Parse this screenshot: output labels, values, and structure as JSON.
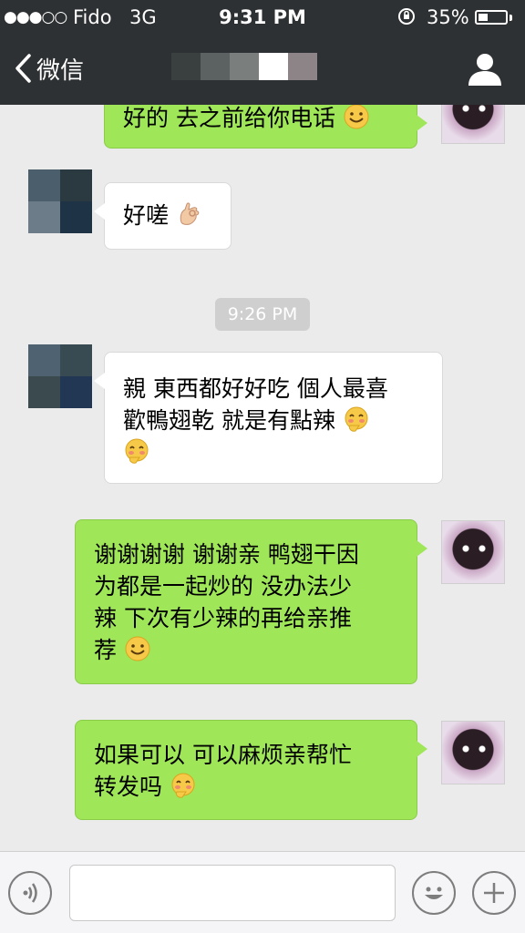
{
  "status_bar": {
    "signal": "●●●○○",
    "carrier": "Fido",
    "network": "3G",
    "time": "9:31 PM",
    "battery_pct": "35%",
    "battery_level": 0.35
  },
  "nav": {
    "back_label": "微信",
    "title_obscured": true
  },
  "messages": [
    {
      "side": "self",
      "text": "好的 去之前给你电话",
      "emoji": "smile"
    },
    {
      "side": "other",
      "text": "好嗟",
      "emoji": "ok-hand"
    },
    {
      "side": "other",
      "lines": [
        "親 東西都好好吃 個人最喜",
        "歡鴨翅乾 就是有點辣",
        ""
      ],
      "emoji": "giggle"
    },
    {
      "side": "self",
      "lines": [
        "谢谢谢谢 谢谢亲 鸭翅干因",
        "为都是一起炒的 没办法少",
        "辣 下次有少辣的再给亲推",
        "荐"
      ],
      "emoji": "smile"
    },
    {
      "side": "self",
      "lines": [
        "如果可以 可以麻烦亲帮忙",
        "转发吗"
      ],
      "emoji": "giggle"
    }
  ],
  "timestamp": "9:26 PM",
  "input_bar": {
    "voice_icon": "voice-icon",
    "emoji_icon": "emoji-icon",
    "plus_icon": "plus-icon",
    "input_value": ""
  },
  "colors": {
    "bar": "#2e3133",
    "chat_bg": "#ebebeb",
    "self_bubble": "#9fe658",
    "other_bubble": "#ffffff"
  }
}
